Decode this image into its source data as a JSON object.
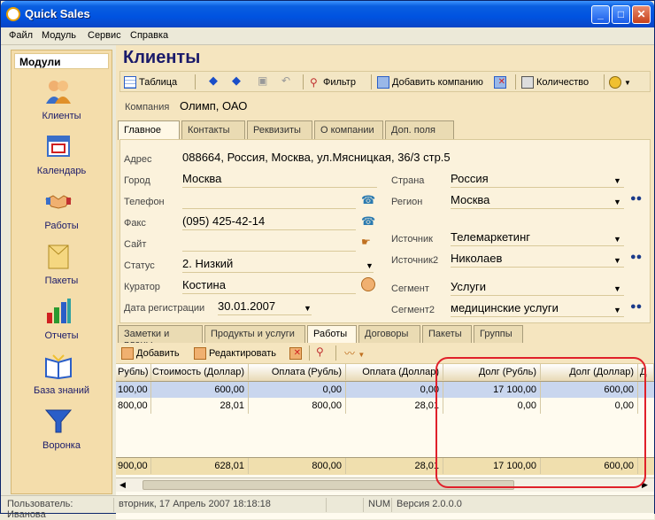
{
  "window": {
    "title": "Quick Sales",
    "minimize": "_",
    "maximize": "□",
    "close": "✕"
  },
  "menu": [
    "Файл",
    "Модуль",
    "Сервис",
    "Справка"
  ],
  "sidebar": {
    "header": "Модули",
    "items": [
      {
        "label": "Клиенты",
        "icon": "clients-icon"
      },
      {
        "label": "Календарь",
        "icon": "calendar-icon"
      },
      {
        "label": "Работы",
        "icon": "handshake-icon"
      },
      {
        "label": "Пакеты",
        "icon": "package-icon"
      },
      {
        "label": "Отчеты",
        "icon": "reports-chart-icon"
      },
      {
        "label": "База знаний",
        "icon": "knowledge-book-icon"
      },
      {
        "label": "Воронка",
        "icon": "funnel-icon"
      }
    ]
  },
  "page": {
    "title": "Клиенты"
  },
  "toolbar": {
    "table": "Таблица",
    "filter": "Фильтр",
    "add_company": "Добавить компанию",
    "count": "Количество"
  },
  "company": {
    "label": "Компания",
    "value": "Олимп, ОАО"
  },
  "tabs": [
    {
      "label": "Главное",
      "active": true
    },
    {
      "label": "Контакты",
      "active": false
    },
    {
      "label": "Реквизиты",
      "active": false
    },
    {
      "label": "О компании",
      "active": false
    },
    {
      "label": "Доп. поля",
      "active": false
    }
  ],
  "form": {
    "address": {
      "label": "Адрес",
      "value": "088664, Россия, Москва, ул.Мясницкая, 36/3 стр.5"
    },
    "city": {
      "label": "Город",
      "value": "Москва"
    },
    "phone": {
      "label": "Телефон",
      "value": ""
    },
    "fax": {
      "label": "Факс",
      "value": "(095) 425-42-14"
    },
    "site": {
      "label": "Сайт",
      "value": ""
    },
    "status": {
      "label": "Статус",
      "value": "2. Низкий"
    },
    "curator": {
      "label": "Куратор",
      "value": "Костина"
    },
    "reg_date": {
      "label": "Дата регистрации",
      "value": "30.01.2007"
    },
    "country": {
      "label": "Страна",
      "value": "Россия"
    },
    "region": {
      "label": "Регион",
      "value": "Москва"
    },
    "source": {
      "label": "Источник",
      "value": "Телемаркетинг"
    },
    "source2": {
      "label": "Источник2",
      "value": "Николаев"
    },
    "segment": {
      "label": "Сегмент",
      "value": "Услуги"
    },
    "segment2": {
      "label": "Сегмент2",
      "value": "медицинские услуги"
    }
  },
  "subtabs": [
    {
      "label": "Заметки и планы",
      "active": false
    },
    {
      "label": "Продукты и услуги",
      "active": false
    },
    {
      "label": "Работы",
      "active": true
    },
    {
      "label": "Договоры",
      "active": false
    },
    {
      "label": "Пакеты",
      "active": false
    },
    {
      "label": "Группы",
      "active": false
    }
  ],
  "subtoolbar": {
    "add": "Добавить",
    "edit": "Редактировать"
  },
  "grid": {
    "columns": [
      "Рубль)",
      "Стоимость (Доллар)",
      "Оплата (Рубль)",
      "Оплата (Доллар)",
      "Долг (Рубль)",
      "Долг (Доллар)",
      "Д"
    ],
    "rows": [
      [
        "100,00",
        "600,00",
        "0,00",
        "0,00",
        "17 100,00",
        "600,00"
      ],
      [
        "800,00",
        "28,01",
        "800,00",
        "28,01",
        "0,00",
        "0,00"
      ]
    ],
    "totals": [
      "900,00",
      "628,01",
      "800,00",
      "28,01",
      "17 100,00",
      "600,00"
    ]
  },
  "status": {
    "user": "Пользователь: Иванова",
    "datetime": "вторник, 17 Апрель 2007 18:18:18",
    "num": "NUM",
    "version": "Версия 2.0.0.0"
  }
}
